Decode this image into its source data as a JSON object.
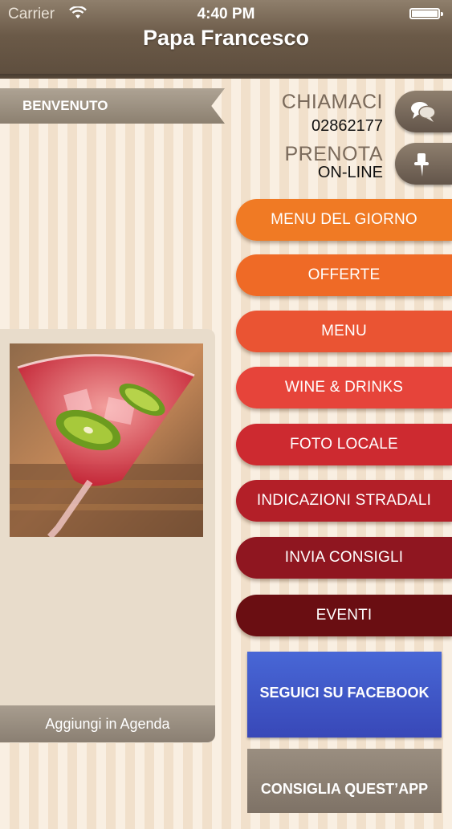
{
  "status_bar": {
    "carrier": "Carrier",
    "time": "4:40 PM"
  },
  "header": {
    "title": "Papa Francesco"
  },
  "welcome": {
    "label": "BENVENUTO"
  },
  "contact": {
    "call_label": "CHIAMACI",
    "phone": "02862177",
    "booking_label": "PRENOTA",
    "booking_sub": "ON-LINE"
  },
  "menu": [
    {
      "label": "MENU DEL GIORNO",
      "color": "#f07a24"
    },
    {
      "label": "OFFERTE",
      "color": "#ef6a26"
    },
    {
      "label": "MENU",
      "color": "#ea5433"
    },
    {
      "label": "WINE & DRINKS",
      "color": "#e6443a"
    },
    {
      "label": "FOTO LOCALE",
      "color": "#cd2a30"
    },
    {
      "label": "INDICAZIONI STRADALI",
      "color": "#b31f28"
    },
    {
      "label": "INVIA CONSIGLI",
      "color": "#8f1620"
    },
    {
      "label": "EVENTI",
      "color": "#6a0e12"
    }
  ],
  "agenda": {
    "label": "Aggiungi in Agenda"
  },
  "social": {
    "facebook_label": "SEGUICI SU FACEBOOK",
    "share_label": "CONSIGLIA QUEST’APP"
  }
}
